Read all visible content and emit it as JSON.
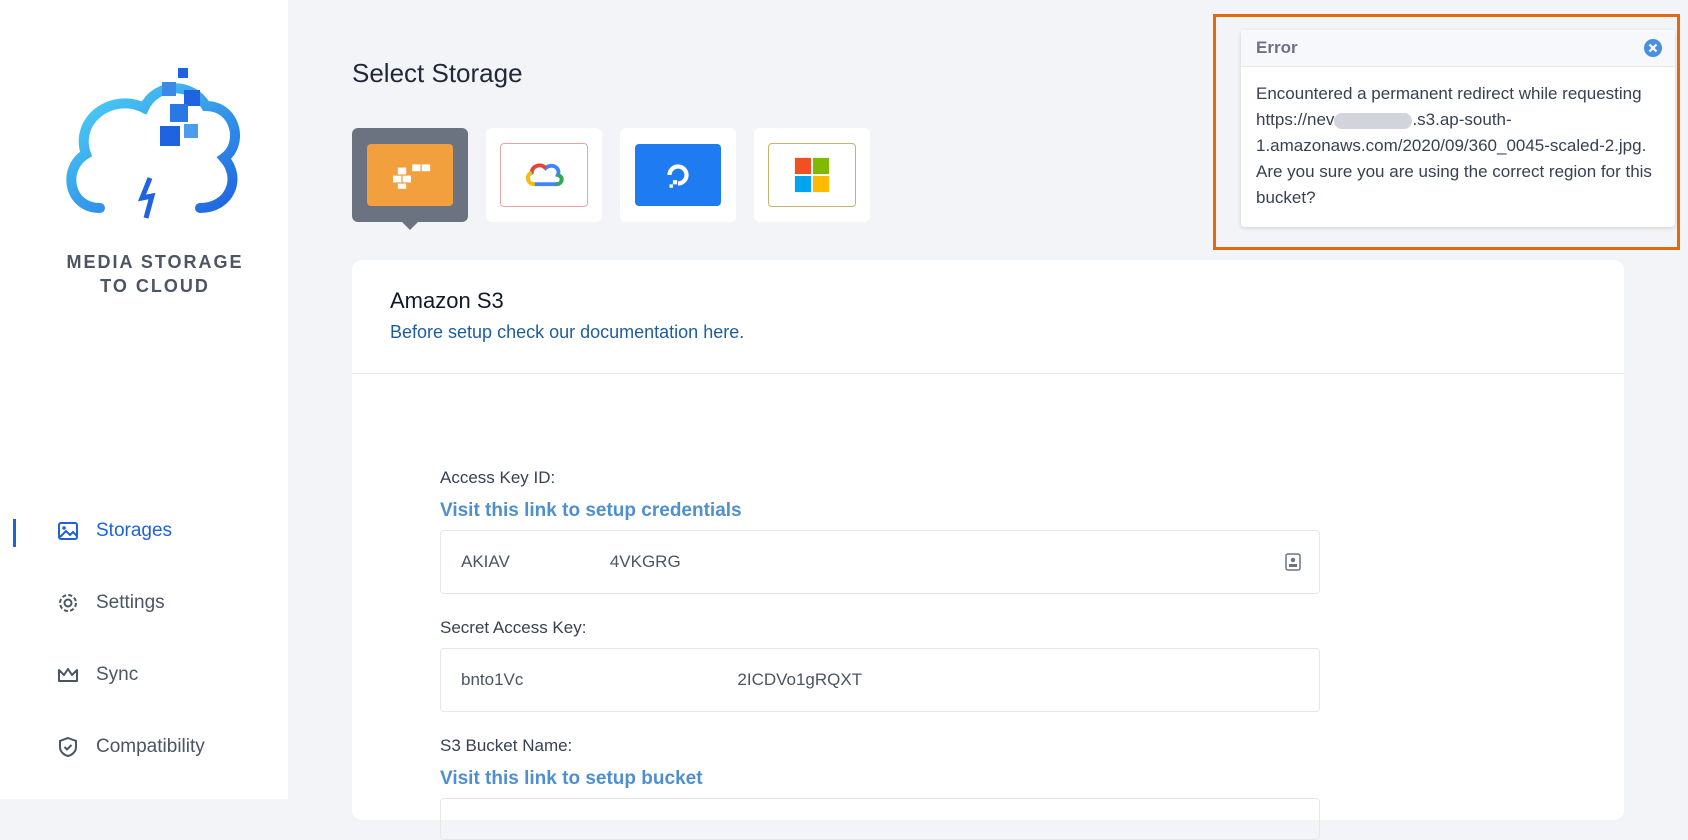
{
  "brand": {
    "line1": "MEDIA STORAGE",
    "line2": "TO CLOUD"
  },
  "nav": [
    {
      "label": "Storages",
      "icon": "image-icon",
      "active": true
    },
    {
      "label": "Settings",
      "icon": "gear-icon",
      "active": false
    },
    {
      "label": "Sync",
      "icon": "crown-icon",
      "active": false
    },
    {
      "label": "Compatibility",
      "icon": "shield-check-icon",
      "active": false
    }
  ],
  "main": {
    "title": "Select Storage",
    "providers": [
      {
        "name": "amazon-s3",
        "icon": "aws-blocks-icon",
        "selected": true
      },
      {
        "name": "google-cloud",
        "icon": "google-cloud-icon",
        "selected": false
      },
      {
        "name": "digitalocean",
        "icon": "digitalocean-icon",
        "selected": false
      },
      {
        "name": "microsoft-azure",
        "icon": "microsoft-icon",
        "selected": false
      }
    ],
    "card": {
      "title": "Amazon S3",
      "subtitle": "Before setup check our documentation here.",
      "fields": {
        "access_key_label": "Access Key ID:",
        "access_key_link": "Visit this link to setup credentials",
        "access_key_start": "AKIAV",
        "access_key_end": "4VKGRG",
        "secret_label": "Secret Access Key:",
        "secret_start": "bnto1Vc",
        "secret_end": "2ICDVo1gRQXT",
        "bucket_label": "S3 Bucket Name:",
        "bucket_link": "Visit this link to setup bucket"
      }
    }
  },
  "error": {
    "title": "Error",
    "text_before": "Encountered a permanent redirect while requesting https://nev",
    "text_after": ".s3.ap-south-1.amazonaws.com/2020/09/360_0045-scaled-2.jpg. Are you sure you are using the correct region for this bucket?"
  },
  "colors": {
    "accent": "#1d63d8",
    "error_outline": "#e26a0c",
    "aws_orange": "#f2a03d",
    "digitalocean_blue": "#1f7bf2"
  }
}
